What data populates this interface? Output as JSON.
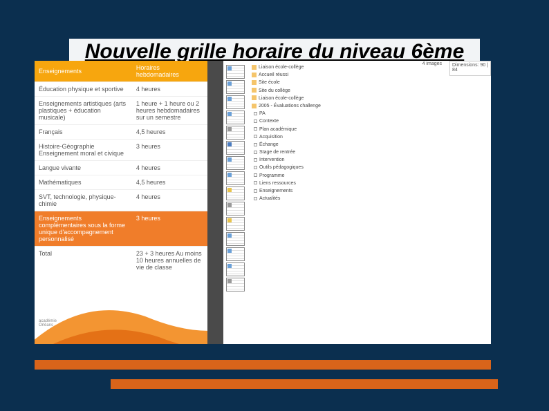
{
  "title": "Nouvelle grille horaire du niveau 6ème",
  "table": {
    "head": {
      "col1": "Enseignements",
      "col2": "Horaires hebdomadaires"
    },
    "rows": [
      {
        "c1": "Éducation physique et sportive",
        "c2": "4 heures"
      },
      {
        "c1": "Enseignements artistiques\n(arts plastiques + éducation musicale)",
        "c2": "1 heure + 1 heure ou 2 heures hebdomadaires sur un semestre"
      },
      {
        "c1": "Français",
        "c2": "4,5 heures"
      },
      {
        "c1": "Histoire-Géographie\nEnseignement moral et civique",
        "c2": "3 heures"
      },
      {
        "c1": "Langue vivante",
        "c2": "4 heures"
      },
      {
        "c1": "Mathématiques",
        "c2": "4,5 heures"
      },
      {
        "c1": "SVT, technologie, physique-chimie",
        "c2": "4 heures"
      },
      {
        "c1": "Enseignements complémentaires sous la forme unique d'accompagnement personnalisé",
        "c2": "3 heures",
        "highlight": true
      },
      {
        "c1": "Total",
        "c2": "23 + 3 heures\nAu moins 10 heures annuelles de vie de classe"
      }
    ]
  },
  "tree": {
    "root": "Liaison école-collège",
    "items": [
      "Accueil réussi",
      "Site école",
      "Site du collège",
      "Liaison école-collège",
      "2005 - Évaluations challenge",
      "PA",
      "Contexte",
      "Plan académique",
      "Acquisition",
      "Échange",
      "Stage de rentrée",
      "Intervention",
      "Outils pédagogiques",
      "Programme",
      "Liens ressources",
      "Enseignements",
      "Actualités"
    ]
  },
  "right_strip": {
    "top": "4 images",
    "box": "Dimensions: 90 | 84"
  },
  "logo_text": "académie Orléans"
}
